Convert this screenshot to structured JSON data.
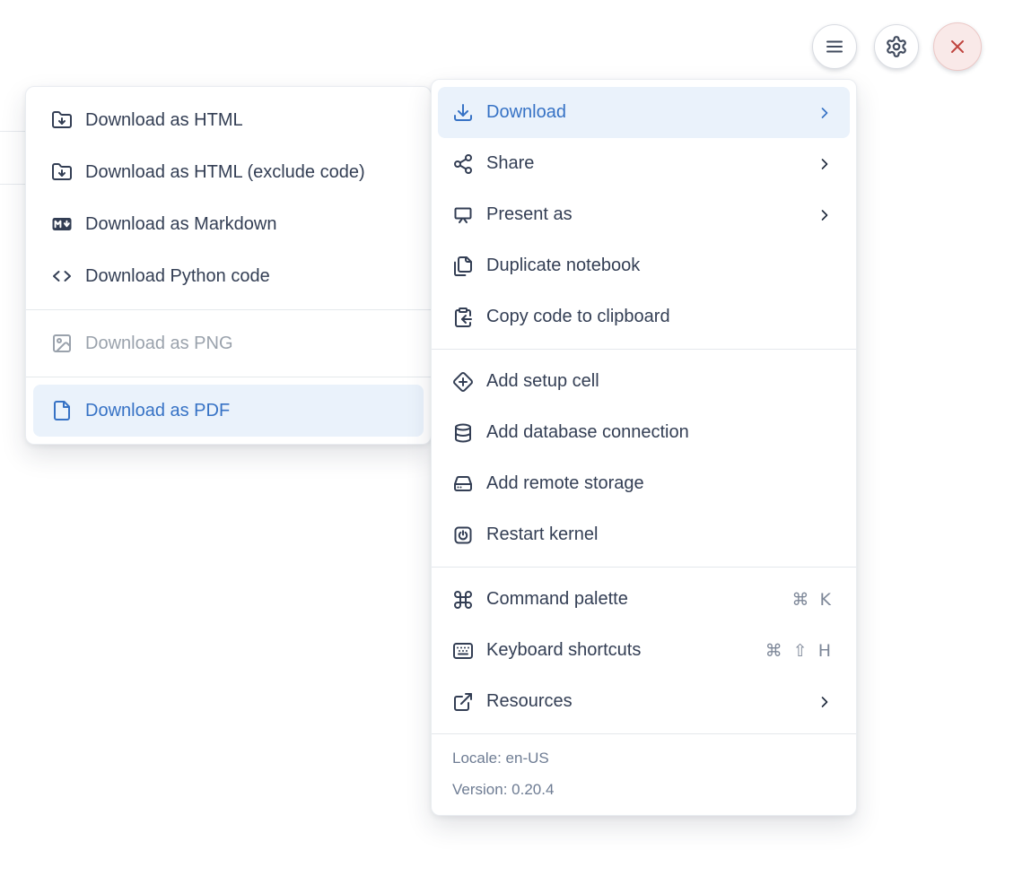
{
  "window_controls": {
    "buttons": [
      {
        "id": "menu",
        "icon": "menu"
      },
      {
        "id": "settings",
        "icon": "gear"
      },
      {
        "id": "close",
        "icon": "close"
      }
    ]
  },
  "download_submenu": {
    "items": [
      {
        "label": "Download as HTML",
        "icon": "folder-download",
        "state": "normal"
      },
      {
        "label": "Download as HTML (exclude code)",
        "icon": "folder-download",
        "state": "normal"
      },
      {
        "label": "Download as Markdown",
        "icon": "markdown",
        "state": "normal"
      },
      {
        "label": "Download Python code",
        "icon": "code",
        "state": "normal",
        "group_end": true
      },
      {
        "label": "Download as PNG",
        "icon": "image",
        "state": "disabled",
        "group_end": true
      },
      {
        "label": "Download as PDF",
        "icon": "file",
        "state": "highlighted"
      }
    ]
  },
  "main_menu": {
    "sections": [
      {
        "items": [
          {
            "label": "Download",
            "icon": "download",
            "state": "highlighted",
            "chevron": true
          },
          {
            "label": "Share",
            "icon": "share",
            "chevron": true
          },
          {
            "label": "Present as",
            "icon": "presentation",
            "chevron": true
          },
          {
            "label": "Duplicate notebook",
            "icon": "duplicate"
          },
          {
            "label": "Copy code to clipboard",
            "icon": "clipboard-copy"
          }
        ]
      },
      {
        "items": [
          {
            "label": "Add setup cell",
            "icon": "diamond-plus"
          },
          {
            "label": "Add database connection",
            "icon": "database"
          },
          {
            "label": "Add remote storage",
            "icon": "hard-drive"
          },
          {
            "label": "Restart kernel",
            "icon": "power"
          }
        ]
      },
      {
        "items": [
          {
            "label": "Command palette",
            "icon": "command",
            "shortcut": "⌘ K"
          },
          {
            "label": "Keyboard shortcuts",
            "icon": "keyboard",
            "shortcut": "⌘ ⇧ H"
          },
          {
            "label": "Resources",
            "icon": "external-link",
            "chevron": true
          }
        ]
      }
    ],
    "footer": {
      "locale": "Locale: en-US",
      "version": "Version: 0.20.4"
    }
  },
  "colors": {
    "accent_blue": "#3672c5",
    "highlight_bg": "#eaf2fb",
    "text_dark": "#333e54",
    "text_disabled": "#9aa2ac",
    "text_footer": "#6e7c93",
    "close_red": "#c0443e",
    "close_bg": "#f9e9e8",
    "separator": "#e4e8ec"
  }
}
